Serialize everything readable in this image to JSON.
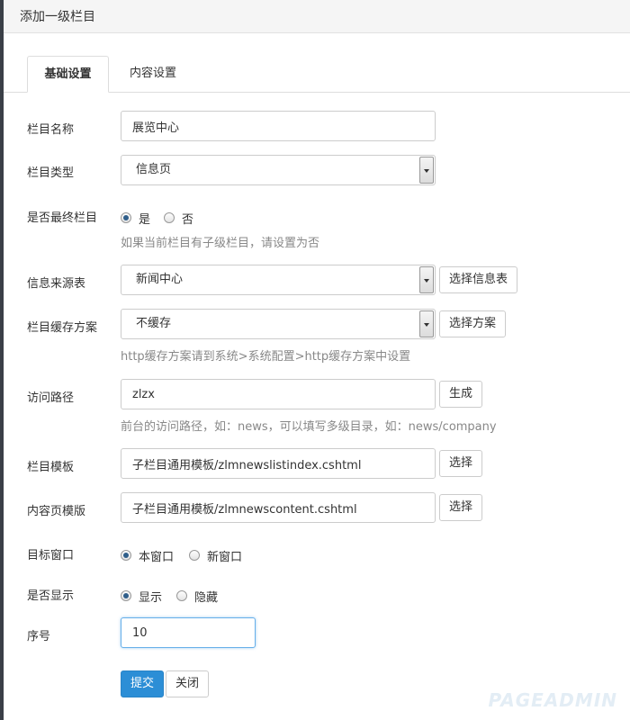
{
  "window": {
    "title": "添加一级栏目"
  },
  "tabs": [
    {
      "label": "基础设置",
      "active": true
    },
    {
      "label": "内容设置",
      "active": false
    }
  ],
  "form": {
    "name": {
      "label": "栏目名称",
      "value": "展览中心"
    },
    "type": {
      "label": "栏目类型",
      "value": "信息页"
    },
    "is_final": {
      "label": "是否最终栏目",
      "options": [
        {
          "label": "是",
          "checked": true
        },
        {
          "label": "否",
          "checked": false
        }
      ],
      "help": "如果当前栏目有子级栏目，请设置为否"
    },
    "source": {
      "label": "信息来源表",
      "value": "新闻中心",
      "button": "选择信息表"
    },
    "cache": {
      "label": "栏目缓存方案",
      "value": "不缓存",
      "button": "选择方案",
      "help": "http缓存方案请到系统>系统配置>http缓存方案中设置"
    },
    "path": {
      "label": "访问路径",
      "value": "zlzx",
      "button": "生成",
      "help": "前台的访问路径，如：news，可以填写多级目录，如：news/company"
    },
    "template": {
      "label": "栏目模板",
      "value": "子栏目通用模板/zlmnewslistindex.cshtml",
      "button": "选择"
    },
    "content_template": {
      "label": "内容页模版",
      "value": "子栏目通用模板/zlmnewscontent.cshtml",
      "button": "选择"
    },
    "target": {
      "label": "目标窗口",
      "options": [
        {
          "label": "本窗口",
          "checked": true
        },
        {
          "label": "新窗口",
          "checked": false
        }
      ]
    },
    "display": {
      "label": "是否显示",
      "options": [
        {
          "label": "显示",
          "checked": true
        },
        {
          "label": "隐藏",
          "checked": false
        }
      ]
    },
    "order": {
      "label": "序号",
      "value": "10"
    }
  },
  "actions": {
    "submit": "提交",
    "close": "关闭"
  },
  "watermark": "PAGEADMIN"
}
